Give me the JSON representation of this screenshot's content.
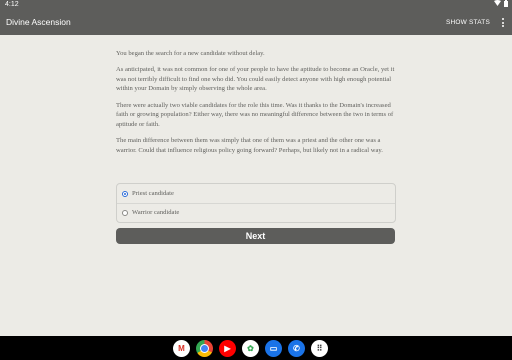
{
  "status_bar": {
    "time": "4:12"
  },
  "app_bar": {
    "title": "Divine Ascension",
    "show_stats_label": "SHOW STATS"
  },
  "story": {
    "paragraphs": [
      "You began the search for a new candidate without delay.",
      "As anticipated, it was not common for one of your people to have the aptitude to become an Oracle, yet it was not terribly difficult to find one who did. You could easily detect anyone with high enough potential within your Domain by simply observing the whole area.",
      "There were actually two viable candidates for the role this time. Was it thanks to the Domain's increased faith or growing population? Either way, there was no meaningful difference between the two in terms of aptitude or faith.",
      "The main difference between them was simply that one of them was a priest and the other one was a warrior. Could that influence religious policy going forward? Perhaps, but likely not in a radical way."
    ]
  },
  "choices": {
    "options": [
      {
        "label": "Priest candidate",
        "selected": true
      },
      {
        "label": "Warrior candidate",
        "selected": false
      }
    ]
  },
  "next_button": {
    "label": "Next"
  },
  "dock": {
    "apps": [
      {
        "icon": "gmail-icon",
        "glyph": "M",
        "color": "#ffffff",
        "text_color": "#d93025"
      },
      {
        "icon": "chrome-icon",
        "glyph": "",
        "color": "#4285f4",
        "text_color": "#ffffff"
      },
      {
        "icon": "youtube-icon",
        "glyph": "▶",
        "color": "#ff0000",
        "text_color": "#ffffff"
      },
      {
        "icon": "photos-icon",
        "glyph": "✿",
        "color": "#ffffff",
        "text_color": "#34a853"
      },
      {
        "icon": "messages-icon",
        "glyph": "▭",
        "color": "#1a73e8",
        "text_color": "#ffffff"
      },
      {
        "icon": "phone-icon",
        "glyph": "✆",
        "color": "#1a73e8",
        "text_color": "#ffffff"
      },
      {
        "icon": "app-drawer-icon",
        "glyph": "⠿",
        "color": "#ffffff",
        "text_color": "#444444"
      }
    ]
  }
}
